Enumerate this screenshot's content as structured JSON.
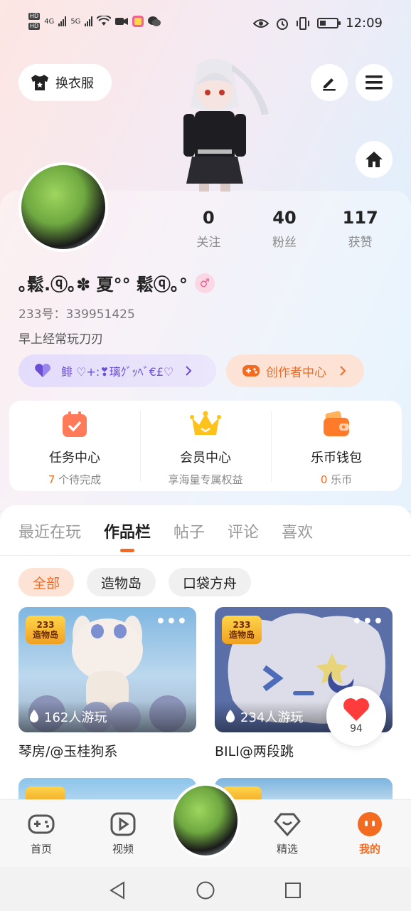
{
  "status_bar": {
    "network_left_1": "HD",
    "network_left_2": "HD",
    "network_1": "4G",
    "network_2": "5G",
    "time": "12:09"
  },
  "header": {
    "outfit_label": "换衣服"
  },
  "profile": {
    "stats": [
      {
        "num": "0",
        "label": "关注"
      },
      {
        "num": "40",
        "label": "粉丝"
      },
      {
        "num": "117",
        "label": "获赞"
      }
    ],
    "nickname": "｡鬆.ⓠ｡✽  夏°° 鬆ⓠ｡°",
    "gender_symbol": "♂",
    "uid": "233号：339951425",
    "bio": "早上经常玩刀刃",
    "guild_pill": "鲱  ♡+:❣璃ｸﾞｯﾍﾞ€£♡",
    "creator_pill": "创作者中心"
  },
  "quick": [
    {
      "title": "任务中心",
      "highlight": "7",
      "sub": "个待完成"
    },
    {
      "title": "会员中心",
      "highlight": "",
      "sub": "享海量专属权益"
    },
    {
      "title": "乐币钱包",
      "highlight": "0",
      "sub": "乐币"
    }
  ],
  "tabs": [
    "最近在玩",
    "作品栏",
    "帖子",
    "评论",
    "喜欢"
  ],
  "chips": [
    "全部",
    "造物岛",
    "口袋方舟"
  ],
  "cards": [
    {
      "badge_top": "233",
      "badge_bottom": "造物岛",
      "plays": "162人游玩",
      "title": "琴房/@玉桂狗系"
    },
    {
      "badge_top": "233",
      "badge_bottom": "造物岛",
      "plays": "234人游玩",
      "title": "BILI@两段跳"
    }
  ],
  "like_count": "94",
  "nav": [
    {
      "label": "首页"
    },
    {
      "label": "视频"
    },
    {
      "label": "精选"
    },
    {
      "label": "我的"
    }
  ],
  "colors": {
    "accent": "#f26b21",
    "purple": "#6a4fd6"
  }
}
